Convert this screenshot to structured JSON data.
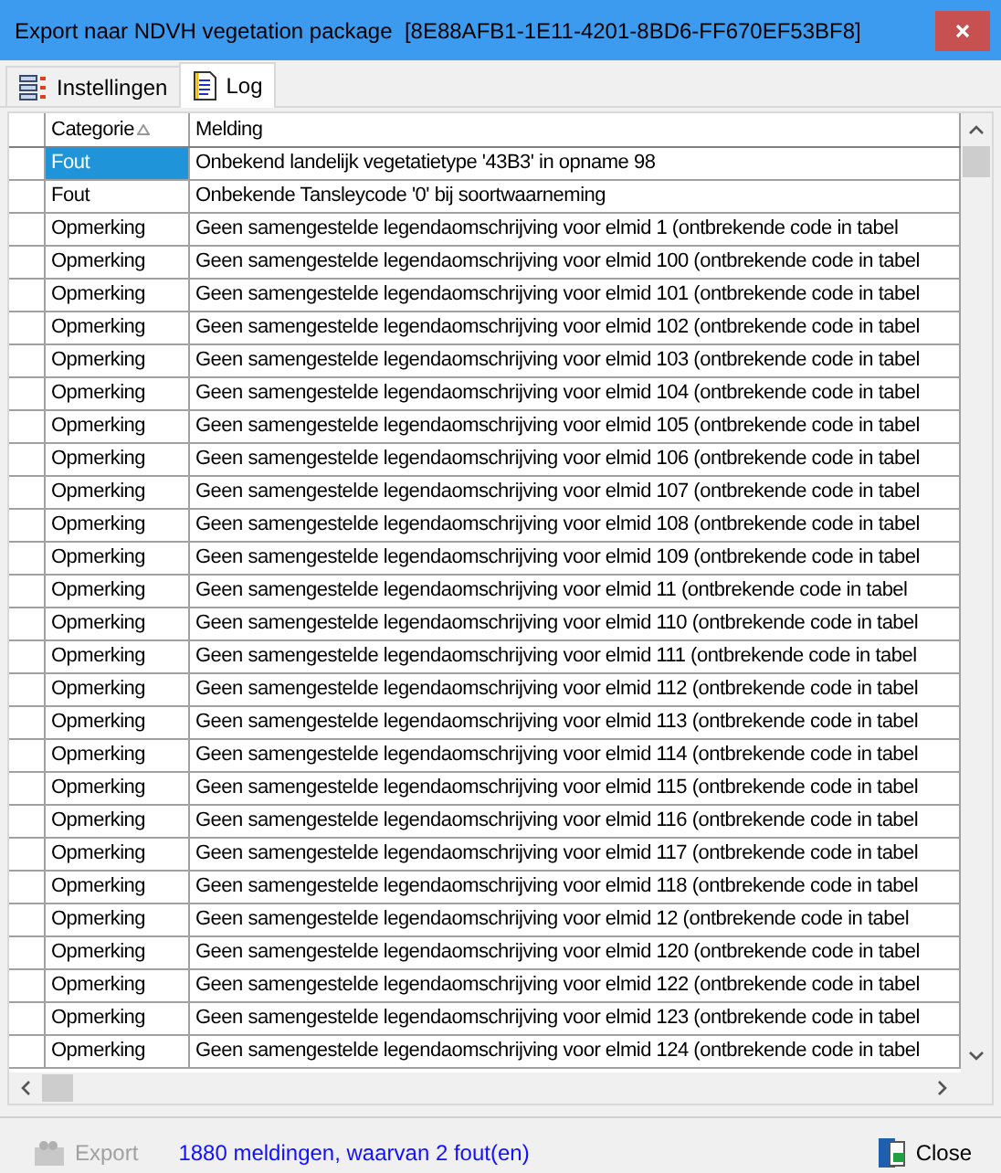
{
  "window": {
    "title": "Export naar NDVH vegetation package  [8E88AFB1-1E11-4201-8BD6-FF670EF53BF8]"
  },
  "tabs": [
    {
      "label": "Instellingen",
      "kind": "settings",
      "selected": false
    },
    {
      "label": "Log",
      "kind": "log",
      "selected": true
    }
  ],
  "table": {
    "columns": [
      {
        "label": "Categorie",
        "sorted": true
      },
      {
        "label": "Melding",
        "sorted": false
      }
    ],
    "rows": [
      {
        "categorie": "Fout",
        "melding": "Onbekend landelijk vegetatietype '43B3' in opname 98",
        "selected": true
      },
      {
        "categorie": "Fout",
        "melding": "Onbekende Tansleycode '0' bij soortwaarneming",
        "selected": false
      },
      {
        "categorie": "Opmerking",
        "melding": "Geen samengestelde legendaomschrijving voor elmid 1 (ontbrekende code in tabel",
        "selected": false
      },
      {
        "categorie": "Opmerking",
        "melding": "Geen samengestelde legendaomschrijving voor elmid 100 (ontbrekende code in tabel",
        "selected": false
      },
      {
        "categorie": "Opmerking",
        "melding": "Geen samengestelde legendaomschrijving voor elmid 101 (ontbrekende code in tabel",
        "selected": false
      },
      {
        "categorie": "Opmerking",
        "melding": "Geen samengestelde legendaomschrijving voor elmid 102 (ontbrekende code in tabel",
        "selected": false
      },
      {
        "categorie": "Opmerking",
        "melding": "Geen samengestelde legendaomschrijving voor elmid 103 (ontbrekende code in tabel",
        "selected": false
      },
      {
        "categorie": "Opmerking",
        "melding": "Geen samengestelde legendaomschrijving voor elmid 104 (ontbrekende code in tabel",
        "selected": false
      },
      {
        "categorie": "Opmerking",
        "melding": "Geen samengestelde legendaomschrijving voor elmid 105 (ontbrekende code in tabel",
        "selected": false
      },
      {
        "categorie": "Opmerking",
        "melding": "Geen samengestelde legendaomschrijving voor elmid 106 (ontbrekende code in tabel",
        "selected": false
      },
      {
        "categorie": "Opmerking",
        "melding": "Geen samengestelde legendaomschrijving voor elmid 107 (ontbrekende code in tabel",
        "selected": false
      },
      {
        "categorie": "Opmerking",
        "melding": "Geen samengestelde legendaomschrijving voor elmid 108 (ontbrekende code in tabel",
        "selected": false
      },
      {
        "categorie": "Opmerking",
        "melding": "Geen samengestelde legendaomschrijving voor elmid 109 (ontbrekende code in tabel",
        "selected": false
      },
      {
        "categorie": "Opmerking",
        "melding": "Geen samengestelde legendaomschrijving voor elmid 11 (ontbrekende code in tabel",
        "selected": false
      },
      {
        "categorie": "Opmerking",
        "melding": "Geen samengestelde legendaomschrijving voor elmid 110 (ontbrekende code in tabel",
        "selected": false
      },
      {
        "categorie": "Opmerking",
        "melding": "Geen samengestelde legendaomschrijving voor elmid 111 (ontbrekende code in tabel",
        "selected": false
      },
      {
        "categorie": "Opmerking",
        "melding": "Geen samengestelde legendaomschrijving voor elmid 112 (ontbrekende code in tabel",
        "selected": false
      },
      {
        "categorie": "Opmerking",
        "melding": "Geen samengestelde legendaomschrijving voor elmid 113 (ontbrekende code in tabel",
        "selected": false
      },
      {
        "categorie": "Opmerking",
        "melding": "Geen samengestelde legendaomschrijving voor elmid 114 (ontbrekende code in tabel",
        "selected": false
      },
      {
        "categorie": "Opmerking",
        "melding": "Geen samengestelde legendaomschrijving voor elmid 115 (ontbrekende code in tabel",
        "selected": false
      },
      {
        "categorie": "Opmerking",
        "melding": "Geen samengestelde legendaomschrijving voor elmid 116 (ontbrekende code in tabel",
        "selected": false
      },
      {
        "categorie": "Opmerking",
        "melding": "Geen samengestelde legendaomschrijving voor elmid 117 (ontbrekende code in tabel",
        "selected": false
      },
      {
        "categorie": "Opmerking",
        "melding": "Geen samengestelde legendaomschrijving voor elmid 118 (ontbrekende code in tabel",
        "selected": false
      },
      {
        "categorie": "Opmerking",
        "melding": "Geen samengestelde legendaomschrijving voor elmid 12 (ontbrekende code in tabel",
        "selected": false
      },
      {
        "categorie": "Opmerking",
        "melding": "Geen samengestelde legendaomschrijving voor elmid 120 (ontbrekende code in tabel",
        "selected": false
      },
      {
        "categorie": "Opmerking",
        "melding": "Geen samengestelde legendaomschrijving voor elmid 122 (ontbrekende code in tabel",
        "selected": false
      },
      {
        "categorie": "Opmerking",
        "melding": "Geen samengestelde legendaomschrijving voor elmid 123 (ontbrekende code in tabel",
        "selected": false
      },
      {
        "categorie": "Opmerking",
        "melding": "Geen samengestelde legendaomschrijving voor elmid 124 (ontbrekende code in tabel",
        "selected": false
      }
    ]
  },
  "footer": {
    "export": {
      "label": "Export",
      "disabled": true
    },
    "status": "1880 meldingen, waarvan 2 fout(en)",
    "close": {
      "label": "Close"
    }
  }
}
